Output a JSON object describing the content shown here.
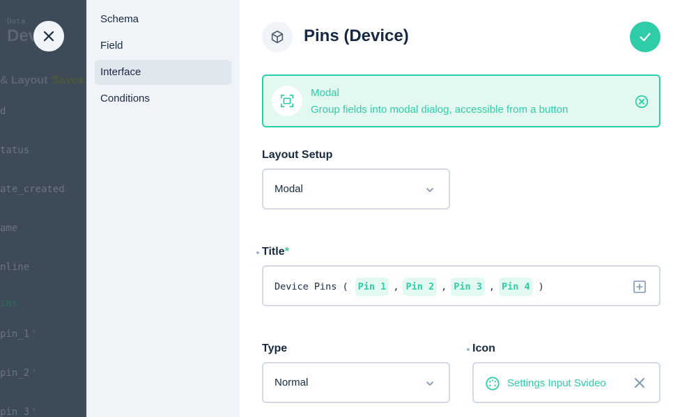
{
  "background": {
    "breadcrumb": "Data",
    "title": "Dev",
    "subheading": "& Layout",
    "saves_label": "Saves",
    "fields": [
      "d",
      "tatus",
      "ate_created",
      "ame",
      "nline",
      "ins",
      "pin_1",
      "pin_2",
      "pin_3"
    ],
    "required_marker": "*"
  },
  "nav": {
    "items": [
      "Schema",
      "Field",
      "Interface",
      "Conditions"
    ],
    "active_index": 2
  },
  "header": {
    "title": "Pins (Device)",
    "icon": "cube-icon",
    "save_icon": "check-icon"
  },
  "interface": {
    "name": "Modal",
    "description": "Group fields into modal dialog, accessible from a button",
    "icon": "fullscreen-icon",
    "remove_icon": "close-circle-icon"
  },
  "layout_setup": {
    "label": "Layout Setup",
    "value": "Modal"
  },
  "title_field": {
    "label": "Title",
    "required_marker": "*",
    "prefix": "Device Pins (",
    "chips": [
      "Pin 1",
      "Pin 2",
      "Pin 3",
      "Pin 4"
    ],
    "separator": ",",
    "suffix": ")"
  },
  "type_field": {
    "label": "Type",
    "value": "Normal"
  },
  "icon_field": {
    "label": "Icon",
    "value": "Settings Input Svideo",
    "icon": "settings-input-svideo-icon"
  },
  "colors": {
    "accent": "#2ecda7",
    "accent_bg": "#e3f8f1",
    "nav_bg": "#f0f4f9",
    "text": "#172940"
  }
}
